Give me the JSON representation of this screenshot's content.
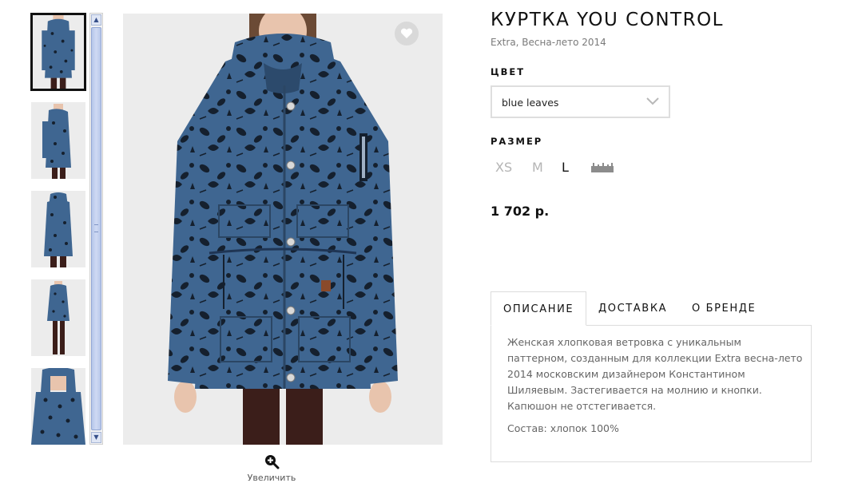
{
  "product": {
    "title": "КУРТКА YOU CONTROL",
    "subtitle": "Extra, Весна-лето 2014",
    "price": "1 702 р."
  },
  "color": {
    "label": "ЦВЕТ",
    "selected": "blue leaves"
  },
  "size": {
    "label": "РАЗМЕР",
    "options": [
      "XS",
      "M",
      "L"
    ],
    "selected": "L",
    "ruler_icon": "ruler-icon"
  },
  "gallery": {
    "thumbnail_count": 5,
    "active_index": 0,
    "favorite_icon": "heart-icon",
    "zoom_icon": "zoom-in-icon",
    "zoom_label": "Увеличить"
  },
  "tabs": {
    "items": [
      "ОПИСАНИЕ",
      "ДОСТАВКА",
      "О БРЕНДЕ"
    ],
    "active": "ОПИСАНИЕ"
  },
  "description": {
    "text": "Женская хлопковая ветровка с уникальным паттерном, созданным для коллекции Extra весна-лето 2014 московским дизайнером Константином Шиляевым. Застегивается на молнию и кнопки. Капюшон не отстегивается.",
    "composition": "Состав: хлопок 100%"
  },
  "colors": {
    "jacket": "#3f6691",
    "pattern": "#15202e",
    "pants": "#3b1e1a",
    "background": "#ececec"
  }
}
